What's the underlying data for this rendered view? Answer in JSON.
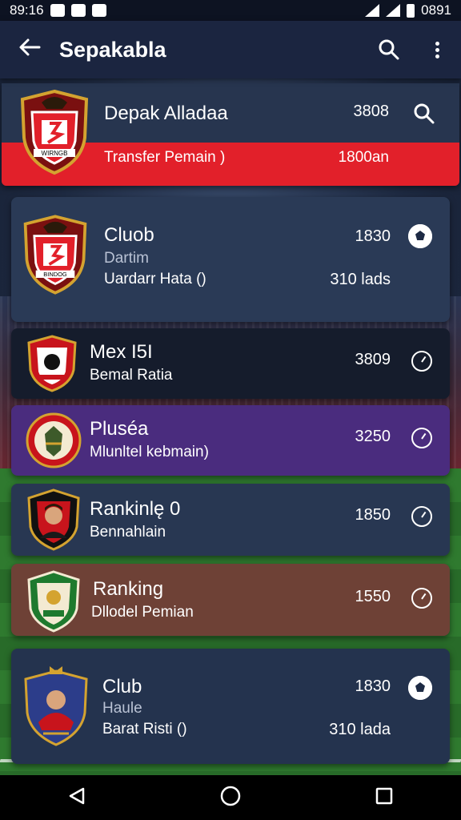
{
  "status_bar": {
    "time": "89:16",
    "right_time": "0891"
  },
  "app_bar": {
    "title": "Sepakabla"
  },
  "featured": {
    "name": "Depak Alladaa",
    "number": "3808",
    "subtitle": "Transfer Pemain )",
    "sub_value": "1800an",
    "crest_text": "WIRNGB"
  },
  "cards": [
    {
      "name": "Cluob",
      "line1": "Dartim",
      "line2": "Uardarr Hata ()",
      "number": "1830",
      "sub_value": "310 lads",
      "crest_text": "BINDOG",
      "icon": "soccer-ball-icon"
    },
    {
      "name": "Mex I5I",
      "line1": "Bemal Ratia",
      "number": "3809",
      "icon": "clock-icon"
    },
    {
      "name": "Pluséa",
      "line1": "Mlunltel kebmain)",
      "number": "3250",
      "icon": "clock-icon"
    },
    {
      "name": "Rankinlę 0",
      "line1": "Bennahlain",
      "number": "1850",
      "icon": "clock-icon"
    },
    {
      "name": "Ranking",
      "line1": "Dllodel Pemian",
      "number": "1550",
      "icon": "clock-icon"
    },
    {
      "name": "Club",
      "line1": "Haule",
      "line2": "Barat Risti ()",
      "number": "1830",
      "sub_value": "310 lada",
      "icon": "soccer-ball-icon"
    }
  ],
  "colors": {
    "accent_red": "#e2202a",
    "purple_card": "#4a2c7e",
    "brown_card": "#6e4136",
    "app_bar": "#1b2540"
  }
}
